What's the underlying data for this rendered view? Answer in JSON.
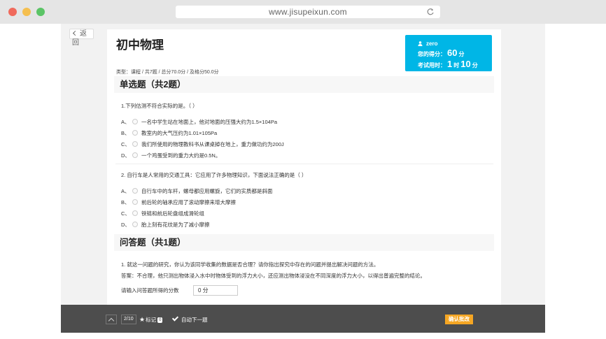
{
  "browser": {
    "url": "www.jisupeixun.com"
  },
  "nav": {
    "back_label": "返回"
  },
  "header": {
    "title": "初中物理",
    "meta": "类型：课程 / 共7题 / 总分70.0分 / 及格分50.0分"
  },
  "score_box": {
    "username": "zero",
    "score_label": "您的得分：",
    "score_value": "60",
    "score_unit": "分",
    "time_label": "考试用时：",
    "time_hours": "1",
    "time_hours_unit": "时",
    "time_minutes": "10",
    "time_minutes_unit": "分"
  },
  "sections": [
    {
      "title": "单选题（共2题）",
      "questions": [
        {
          "text": "1.下列估测不符合实际的是。（    ）",
          "options": [
            {
              "letter": "A、",
              "text": "一名中学生站在地面上，他对地面的压强大约为1.5×104Pa"
            },
            {
              "letter": "B、",
              "text": "教室内的大气压约为1.01×105Pa"
            },
            {
              "letter": "C、",
              "text": "我们所使用的物理教科书从课桌掉在地上，重力做功约为200J"
            },
            {
              "letter": "D、",
              "text": "一个鸡蛋受到的重力大约是0.5N。"
            }
          ]
        },
        {
          "text": "2. 自行车是人常用的交通工具：它应用了许多物理知识，下面说法正确的是（    ）",
          "options": [
            {
              "letter": "A、",
              "text": "自行车中的车杆，螺母都应用螺旋，它们的实质都是斜面"
            },
            {
              "letter": "B、",
              "text": "前后轮的轴承应用了滚动摩擦来增大摩擦"
            },
            {
              "letter": "C、",
              "text": "铁链和前后轮盘组成滑轮组"
            },
            {
              "letter": "D、",
              "text": "胎上刻有花纹是为了减小摩擦"
            }
          ]
        }
      ]
    },
    {
      "title": "问答题（共1题）",
      "questions": [
        {
          "text": "1. 就这一问题的研究，你认为该同学收集的数据是否合理？请你指出探究中存在的问题并提出解决问题的方法。",
          "answer": "答案：不合理，他只测出物体浸入水中时物体受到的浮力大小，还应测出物体浸没在不同深度的浮力大小，以得出普遍完整的结论。",
          "score_label": "请输入问答题所得的分数",
          "score_value": "0 分"
        }
      ]
    }
  ],
  "bottombar": {
    "progress": "2/10",
    "mark_label": "标记",
    "mark_count": "0",
    "auto_next_label": "自动下一题",
    "confirm_label": "确认批改"
  }
}
